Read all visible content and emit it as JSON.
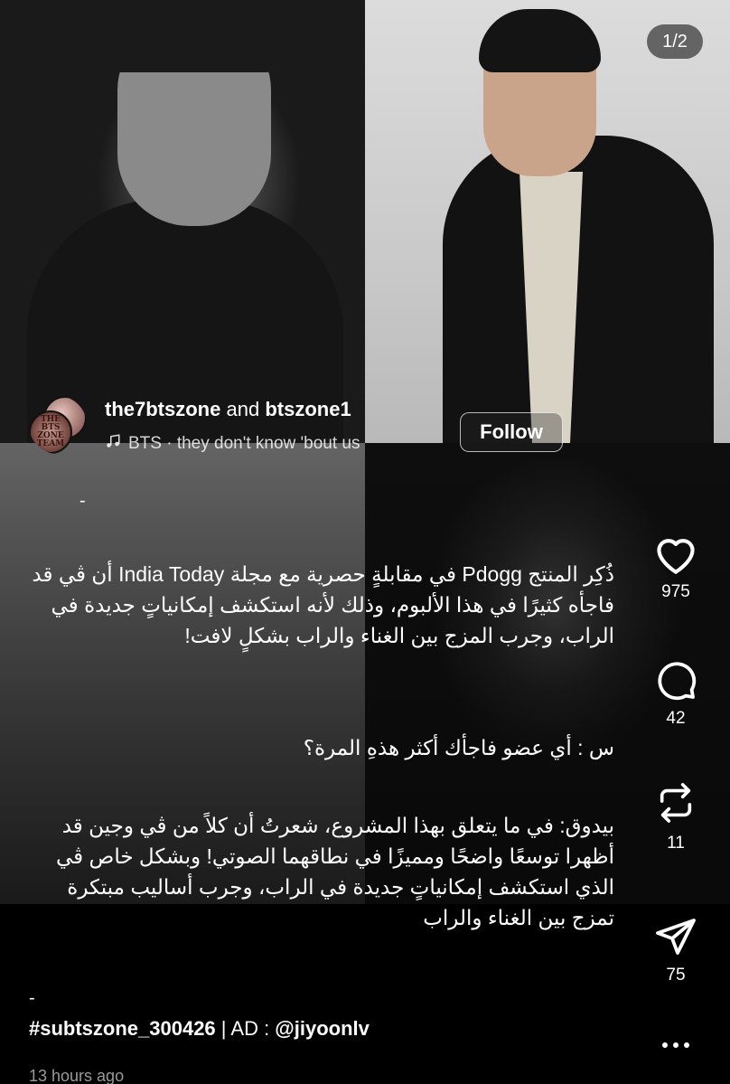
{
  "media": {
    "page_indicator": "1/2"
  },
  "post": {
    "author1": "the7btszone",
    "joiner": "and",
    "author2": "btszone1",
    "music": "BTS · they don't know 'bout us",
    "follow_label": "Follow",
    "avatar_text": "THE BTS ZONE TEAM",
    "dash": "-",
    "caption_p1": "ذُكِر المنتج Pdogg في مقابلةٍ حصرية مع مجلة India Today أن ڤي قد فاجأه كثيرًا في هذا الألبوم، وذلك لأنه استكشف إمكانياتٍ جديدة في الراب، وجرب المزج بين الغناء والراب بشكلٍ لافت!",
    "caption_p2": "س : أي عضو فاجأك أكثر هذهِ المرة؟",
    "caption_p3": "بيدوق: في ما يتعلق بهذا المشروع، شعرتُ أن كلاً من ڤي وجين قد أظهرا توسعًا واضحًا ومميزًا في نطاقهما الصوتي! وبشكل خاص ڤي الذي استكشف إمكانياتٍ جديدة في الراب، وجرب أساليب مبتكرة تمزج بين الغناء والراب",
    "hashtag": "#subtszone_300426",
    "ad_text": " | AD : ",
    "ad_handle": "@jiyoonlv",
    "timestamp": "13 hours ago"
  },
  "actions": {
    "likes": "975",
    "comments": "42",
    "reposts": "11",
    "shares": "75"
  },
  "icons": {
    "like": "heart-icon",
    "comment": "comment-icon",
    "repost": "repost-icon",
    "share": "send-icon",
    "more": "more-icon",
    "music": "music-note-icon"
  }
}
